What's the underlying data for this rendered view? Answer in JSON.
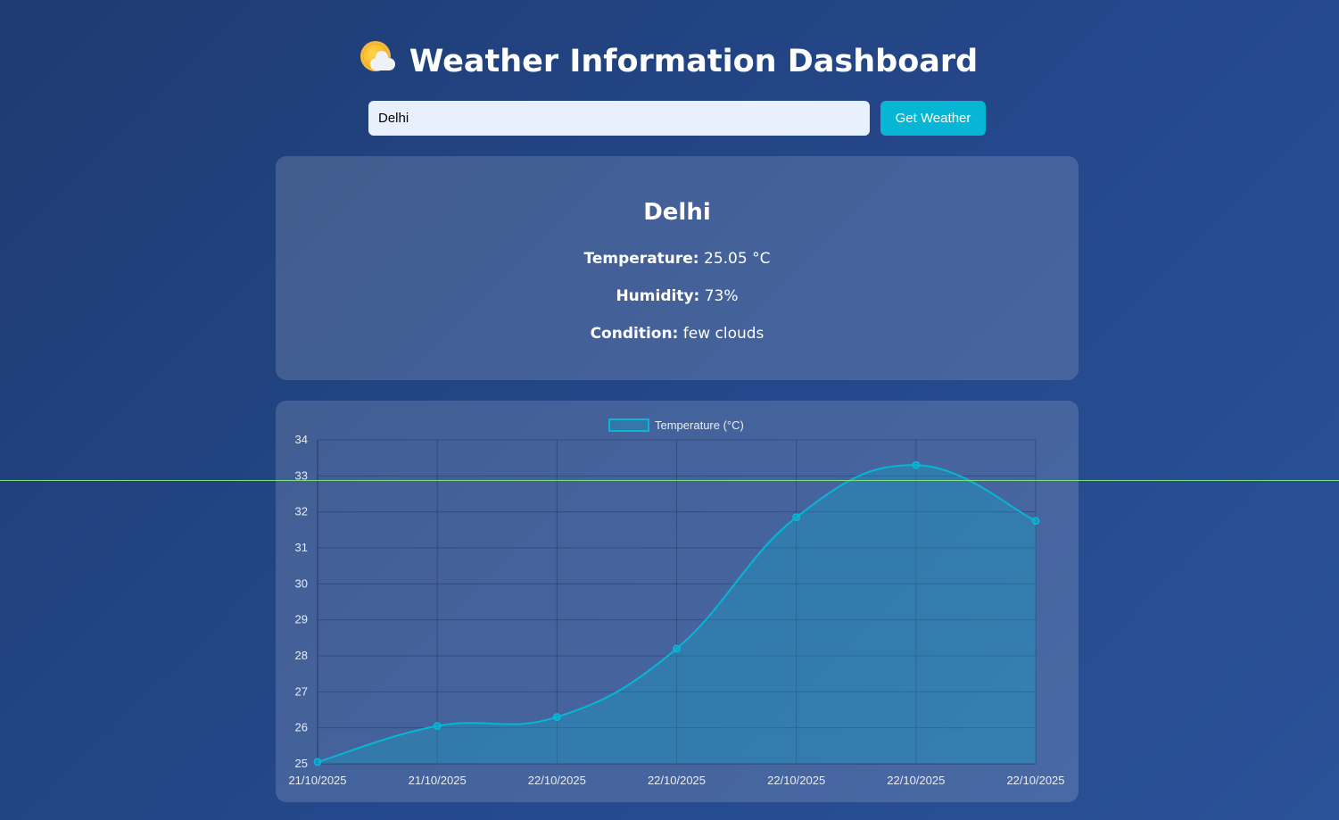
{
  "header": {
    "icon": "sun-behind-cloud-icon",
    "title": "Weather Information Dashboard"
  },
  "search": {
    "value": "Delhi",
    "button_label": "Get Weather"
  },
  "weather": {
    "city": "Delhi",
    "temperature_label": "Temperature:",
    "temperature_value": "25.05 °C",
    "humidity_label": "Humidity:",
    "humidity_value": "73%",
    "condition_label": "Condition:",
    "condition_value": "few clouds"
  },
  "colors": {
    "accent": "#06b6d4",
    "overlay_line": "#7ee07e"
  },
  "chart_data": {
    "type": "line",
    "fill": "area",
    "categories": [
      "21/10/2025",
      "21/10/2025",
      "22/10/2025",
      "22/10/2025",
      "22/10/2025",
      "22/10/2025",
      "22/10/2025"
    ],
    "series": [
      {
        "name": "Temperature (°C)",
        "values": [
          25.05,
          26.05,
          26.3,
          28.2,
          31.85,
          33.3,
          31.75
        ],
        "color": "#06b6d4"
      }
    ],
    "yticks": [
      "25",
      "26",
      "27",
      "28",
      "29",
      "30",
      "31",
      "32",
      "33",
      "34"
    ],
    "ylim": [
      25,
      34
    ],
    "grid": true,
    "legend": "top-center",
    "title": "",
    "xlabel": "",
    "ylabel": ""
  }
}
